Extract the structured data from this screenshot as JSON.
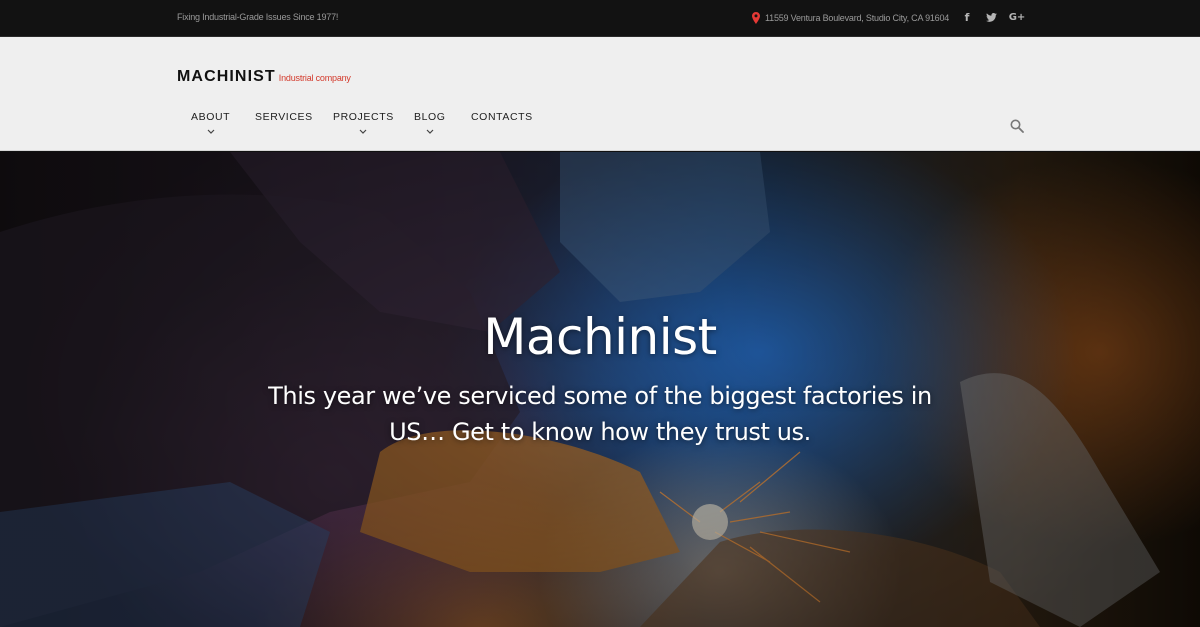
{
  "topbar": {
    "tagline": "Fixing Industrial-Grade Issues Since 1977!",
    "address": "11559 Ventura Boulevard, Studio City, CA 91604",
    "social": {
      "facebook": "f",
      "twitter": "t",
      "google_plus": "G+"
    },
    "icons": [
      "map-pin-icon",
      "facebook-icon",
      "twitter-icon",
      "google-plus-icon"
    ],
    "pin_color": "#e53935"
  },
  "header": {
    "logo": "MACHINIST",
    "logo_sub": "Industrial company",
    "accent": "#d33a2c",
    "nav": [
      {
        "label": "ABOUT",
        "has_dropdown": true
      },
      {
        "label": "SERVICES",
        "has_dropdown": false
      },
      {
        "label": "PROJECTS",
        "has_dropdown": true
      },
      {
        "label": "BLOG",
        "has_dropdown": true
      },
      {
        "label": "CONTACTS",
        "has_dropdown": false
      }
    ],
    "search_icon": "search-icon"
  },
  "hero": {
    "title": "Machinist",
    "subtitle": "This year we’ve serviced some of the biggest factories in US… Get to know how they trust us."
  }
}
